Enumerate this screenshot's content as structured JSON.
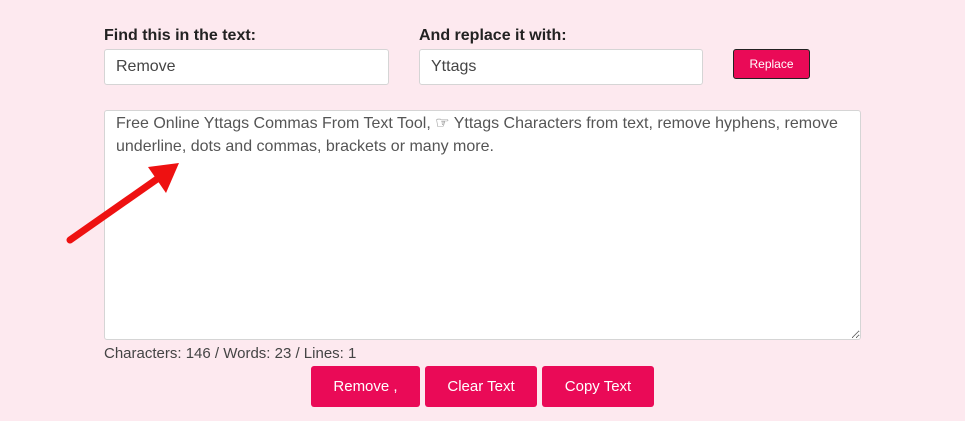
{
  "find": {
    "label": "Find this in the text:",
    "value": "Remove"
  },
  "replace": {
    "label": "And replace it with:",
    "value": "Yttags",
    "button_label": "Replace"
  },
  "editor": {
    "text": "Free Online Yttags Commas From Text Tool, ☞ Yttags Characters from text, remove hyphens, remove underline, dots and commas, brackets or many more."
  },
  "stats": {
    "text": "Characters: 146 / Words: 23 / Lines: 1"
  },
  "actions": {
    "remove_label": "Remove ,",
    "clear_label": "Clear Text",
    "copy_label": "Copy Text"
  },
  "colors": {
    "accent": "#ea0a57",
    "background": "#fde9ef",
    "arrow": "#ee1111"
  },
  "annotation": {
    "icon": "red-arrow-icon"
  }
}
